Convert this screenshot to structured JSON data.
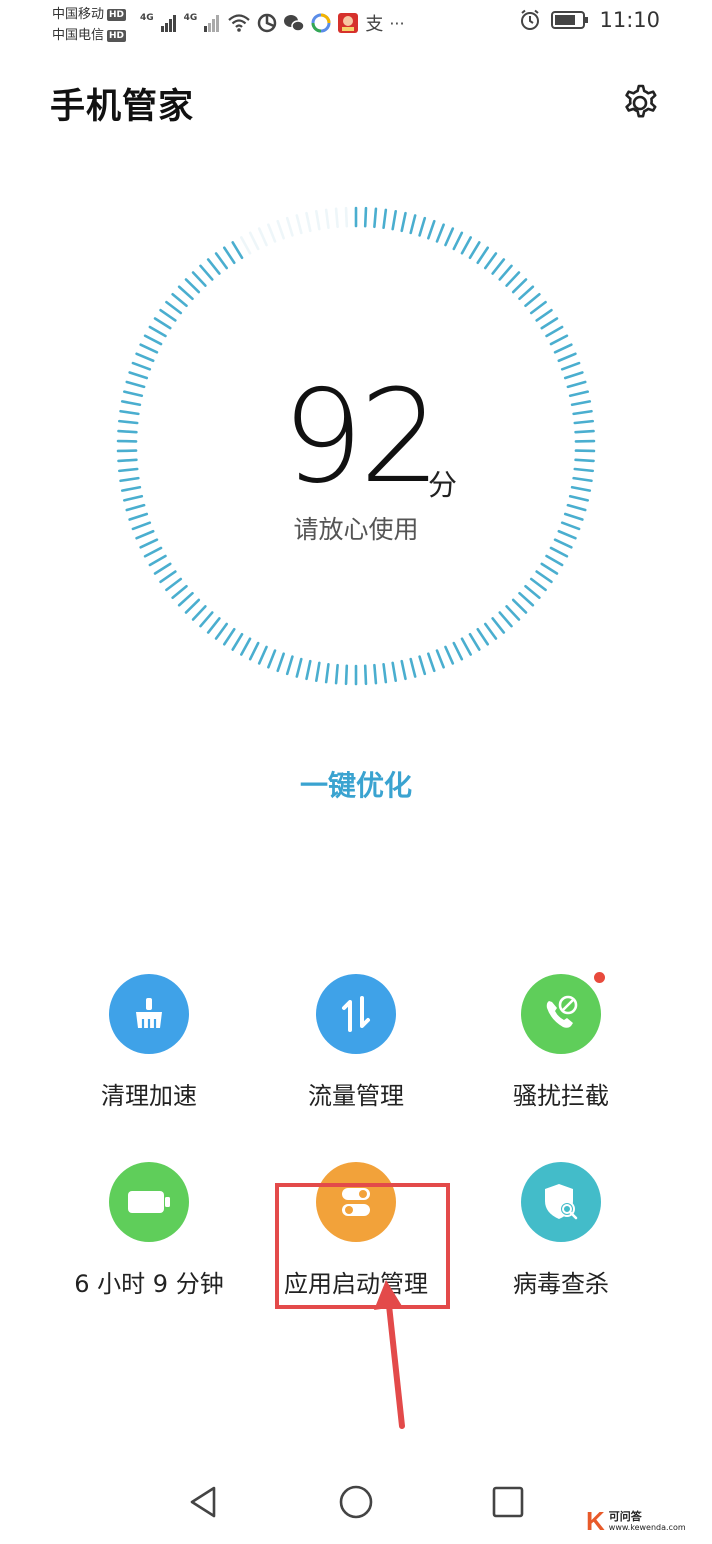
{
  "status_bar": {
    "carrier_1": "中国移动",
    "carrier_2": "中国电信",
    "hd_badge": "HD",
    "network": "4G",
    "alipay_glyph": "支",
    "more": "···",
    "time": "11:10"
  },
  "header": {
    "title": "手机管家",
    "settings_icon": "gear-icon"
  },
  "score": {
    "value": "92",
    "unit": "分",
    "subtitle": "请放心使用",
    "level": 0.92
  },
  "optimize_label": "一键优化",
  "tools": [
    {
      "label": "清理加速",
      "icon": "broom-icon",
      "color": "#3fa2e8"
    },
    {
      "label": "流量管理",
      "icon": "data-transfer-icon",
      "color": "#3fa2e8"
    },
    {
      "label": "骚扰拦截",
      "icon": "phone-block-icon",
      "color": "#5fce5a",
      "badge": true
    },
    {
      "label": "6 小时 9 分钟",
      "icon": "battery-icon",
      "color": "#5fce5a"
    },
    {
      "label": "应用启动管理",
      "icon": "toggle-icon",
      "color": "#f2a23a"
    },
    {
      "label": "病毒查杀",
      "icon": "shield-scan-icon",
      "color": "#43bcc9"
    }
  ],
  "navbar": {
    "back": "back-icon",
    "home": "home-icon",
    "recents": "recents-icon"
  },
  "watermark": {
    "logo": "K",
    "text_1": "可问答",
    "text_2": "www.kewenda.com"
  },
  "colors": {
    "gauge": "#4aaecf",
    "accent": "#3aa3d0",
    "annotation": "#e34a4a"
  }
}
